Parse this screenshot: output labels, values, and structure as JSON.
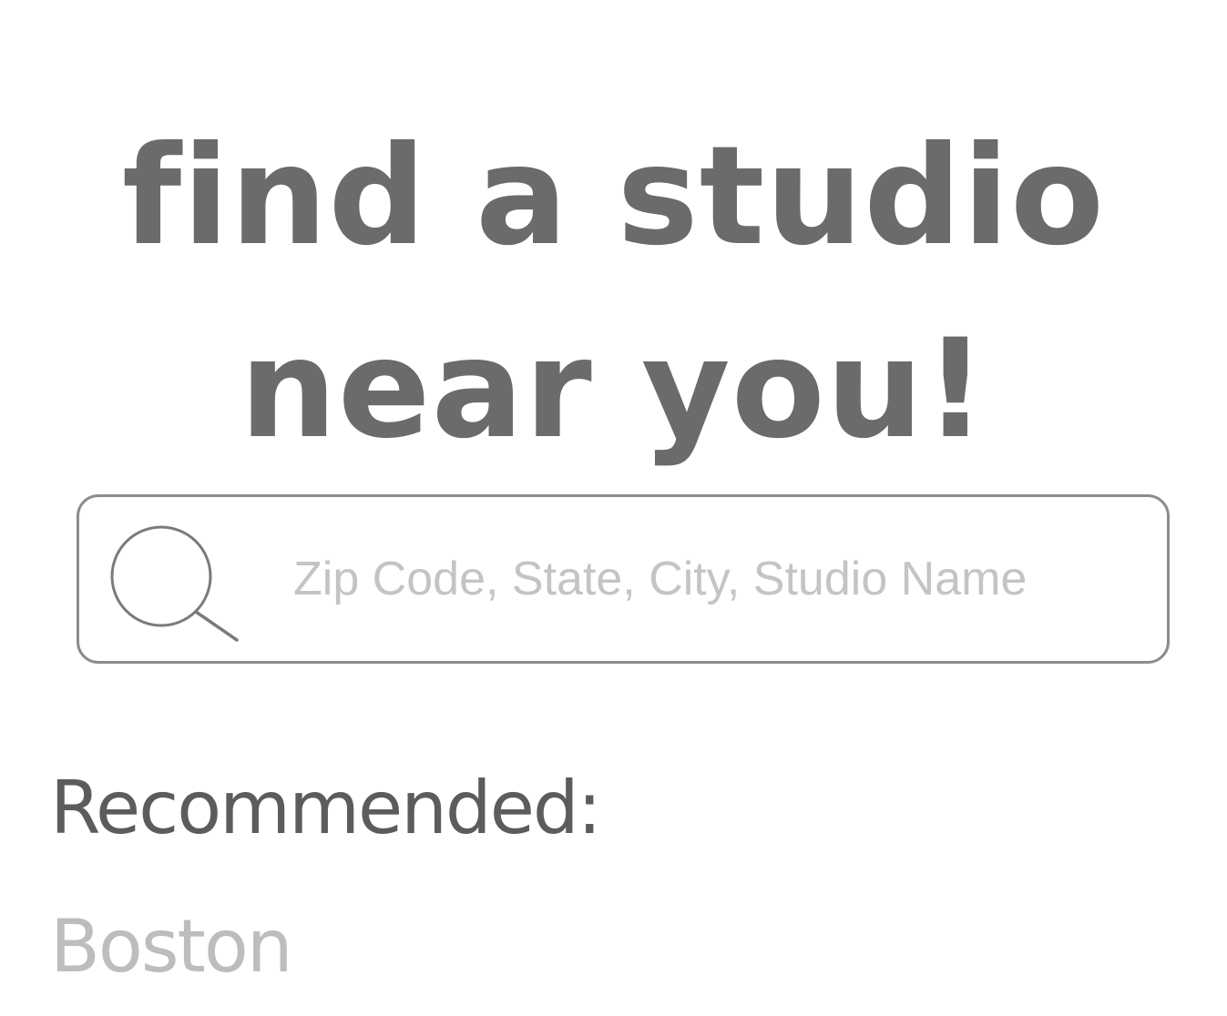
{
  "heading": {
    "line1": "find a studio",
    "line2": "near you!"
  },
  "search": {
    "placeholder": "Zip Code, State, City, Studio Name",
    "value": "",
    "icon": "search-icon"
  },
  "recommended": {
    "label": "Recommended:",
    "items": [
      {
        "label": "Boston"
      }
    ]
  },
  "colors": {
    "heading": "#6b6b6b",
    "border": "#8c8c8c",
    "placeholder": "#c4c4c4",
    "label": "#5c5c5c",
    "item": "#bdbdbd",
    "background": "#ffffff"
  }
}
